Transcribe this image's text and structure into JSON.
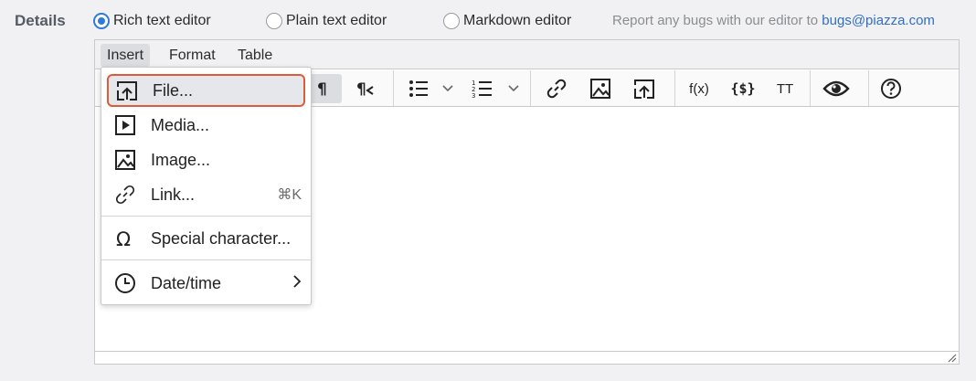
{
  "details_label": "Details",
  "editor_modes": [
    {
      "label": "Rich text editor",
      "checked": true
    },
    {
      "label": "Plain text editor",
      "checked": false
    },
    {
      "label": "Markdown editor",
      "checked": false
    }
  ],
  "bug_note": {
    "text": "Report any bugs with our editor to",
    "email": "bugs@piazza.com"
  },
  "menubar": {
    "insert": "Insert",
    "format": "Format",
    "table": "Table"
  },
  "toolbar": {
    "func": "f(x)",
    "code": "{$}",
    "tt": "TT"
  },
  "insert_menu": {
    "file": "File...",
    "media": "Media...",
    "image": "Image...",
    "link": "Link...",
    "link_shortcut": "⌘K",
    "special_char": "Special character...",
    "datetime": "Date/time"
  },
  "colors": {
    "accent": "#2f7bd8",
    "highlight_border": "#e05a3a",
    "link": "#2f6fc4"
  }
}
